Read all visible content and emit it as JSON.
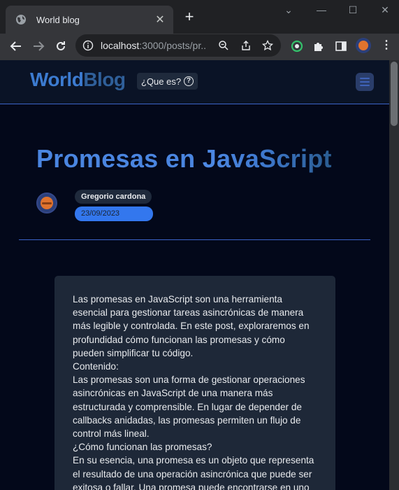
{
  "browser": {
    "tab_title": "World blog",
    "new_tab_label": "+",
    "url_host": "localhost",
    "url_rest": ":3000/posts/pr..."
  },
  "site": {
    "logo_world": "World",
    "logo_blog": "Blog",
    "que_es_label": "¿Que es?",
    "que_es_icon": "?"
  },
  "post": {
    "title_part1": "Promesas en ",
    "title_part2": "JavaScript",
    "author": "Gregorio cardona",
    "date": "23/09/2023",
    "paragraphs": [
      "Las promesas en JavaScript son una herramienta esencial para gestionar tareas asincrónicas de manera más legible y controlada. En este post, exploraremos en profundidad cómo funcionan las promesas y cómo pueden simplificar tu código.",
      "Contenido:",
      "Las promesas son una forma de gestionar operaciones asincrónicas en JavaScript de una manera más estructurada y comprensible. En lugar de depender de callbacks anidadas, las promesas permiten un flujo de control más lineal.",
      "¿Cómo funcionan las promesas?",
      "En su esencia, una promesa es un objeto que representa el resultado de una operación asincrónica que puede ser exitosa o fallar. Una promesa puede encontrarse en uno"
    ]
  },
  "colors": {
    "page_bg": "#03081a",
    "header_bg": "#0a1326",
    "accent": "#3c7bd0",
    "date_badge": "#3377ee",
    "card_bg": "#1e2838"
  }
}
